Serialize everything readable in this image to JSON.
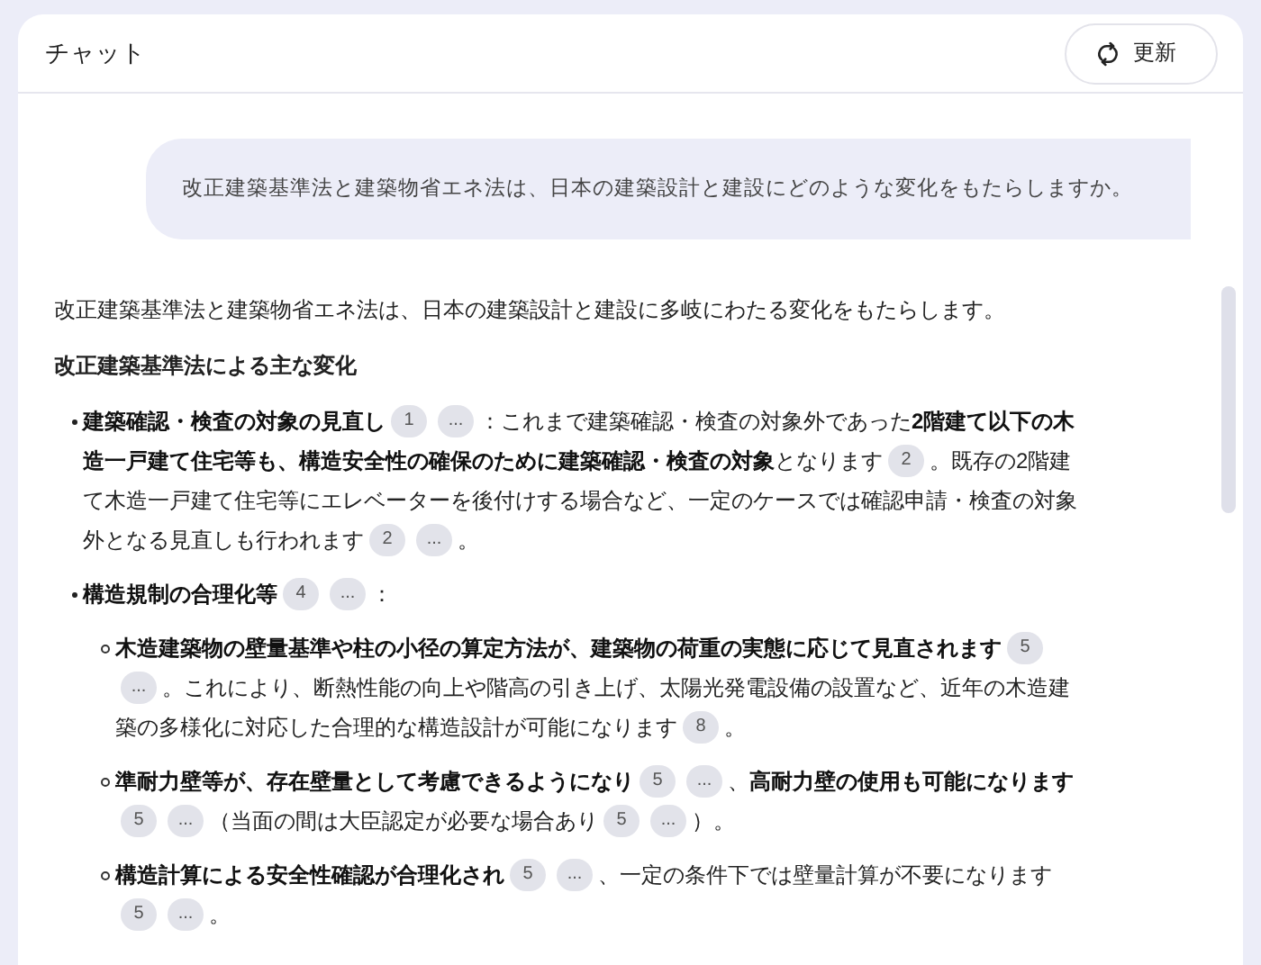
{
  "header": {
    "title": "チャット",
    "refresh_button": "更新"
  },
  "user_message": "改正建築基準法と建築物省エネ法は、日本の建築設計と建設にどのような変化をもたらしますか。",
  "response": {
    "intro": "改正建築基準法と建築物省エネ法は、日本の建築設計と建設に多岐にわたる変化をもたらします。",
    "heading": "改正建築基準法による主な変化",
    "items": [
      {
        "lines": [
          [
            {
              "kind": "text",
              "text": "**建築確認・検査の対象の見直し**"
            },
            {
              "kind": "cite",
              "label": "1"
            },
            {
              "kind": "cite",
              "label": "..."
            },
            {
              "kind": "text",
              "text": "：これまで建築確認・検査の対象外であった**2階建て以下の木**"
            }
          ],
          [
            {
              "kind": "text",
              "text": "**造一戸建て住宅等も、構造安全性の確保のために建築確認・検査の対象**となります"
            },
            {
              "kind": "cite",
              "label": "2"
            },
            {
              "kind": "text",
              "text": "。既存の2階建"
            }
          ],
          [
            {
              "kind": "text",
              "text": "て木造一戸建て住宅等にエレベーターを後付けする場合など、一定のケースでは確認申請・検査の対象"
            }
          ],
          [
            {
              "kind": "text",
              "text": "外となる見直しも行われます"
            },
            {
              "kind": "cite",
              "label": "2"
            },
            {
              "kind": "cite",
              "label": "..."
            },
            {
              "kind": "text",
              "text": "。"
            }
          ]
        ]
      },
      {
        "lines": [
          [
            {
              "kind": "text",
              "text": "**構造規制の合理化等**"
            },
            {
              "kind": "cite",
              "label": "4"
            },
            {
              "kind": "cite",
              "label": "..."
            },
            {
              "kind": "text",
              "text": "："
            }
          ]
        ],
        "children": [
          {
            "lines": [
              [
                {
                  "kind": "text",
                  "text": "**木造建築物の壁量基準や柱の小径の算定方法が、建築物の荷重の実態に応じて見直されます**"
                },
                {
                  "kind": "cite",
                  "label": "5"
                }
              ],
              [
                {
                  "kind": "cite",
                  "label": "..."
                },
                {
                  "kind": "text",
                  "text": "。これにより、断熱性能の向上や階高の引き上げ、太陽光発電設備の設置など、近年の木造建"
                }
              ],
              [
                {
                  "kind": "text",
                  "text": "築の多様化に対応した合理的な構造設計が可能になります"
                },
                {
                  "kind": "cite",
                  "label": "8"
                },
                {
                  "kind": "text",
                  "text": "。"
                }
              ]
            ]
          },
          {
            "lines": [
              [
                {
                  "kind": "text",
                  "text": "**準耐力壁等が、存在壁量として考慮できるようになり**"
                },
                {
                  "kind": "cite",
                  "label": "5"
                },
                {
                  "kind": "cite",
                  "label": "..."
                },
                {
                  "kind": "text",
                  "text": "、**高耐力壁の使用も可能になります**"
                }
              ],
              [
                {
                  "kind": "cite",
                  "label": "5"
                },
                {
                  "kind": "cite",
                  "label": "..."
                },
                {
                  "kind": "text",
                  "text": "（当面の間は大臣認定が必要な場合あり"
                },
                {
                  "kind": "cite",
                  "label": "5"
                },
                {
                  "kind": "cite",
                  "label": "..."
                },
                {
                  "kind": "text",
                  "text": "）。"
                }
              ]
            ]
          },
          {
            "lines": [
              [
                {
                  "kind": "text",
                  "text": "**構造計算による安全性確認が合理化され**"
                },
                {
                  "kind": "cite",
                  "label": "5"
                },
                {
                  "kind": "cite",
                  "label": "..."
                },
                {
                  "kind": "text",
                  "text": "、一定の条件下では壁量計算が不要になります"
                }
              ],
              [
                {
                  "kind": "cite",
                  "label": "5"
                },
                {
                  "kind": "cite",
                  "label": "..."
                },
                {
                  "kind": "text",
                  "text": "。"
                }
              ]
            ]
          }
        ]
      }
    ]
  }
}
